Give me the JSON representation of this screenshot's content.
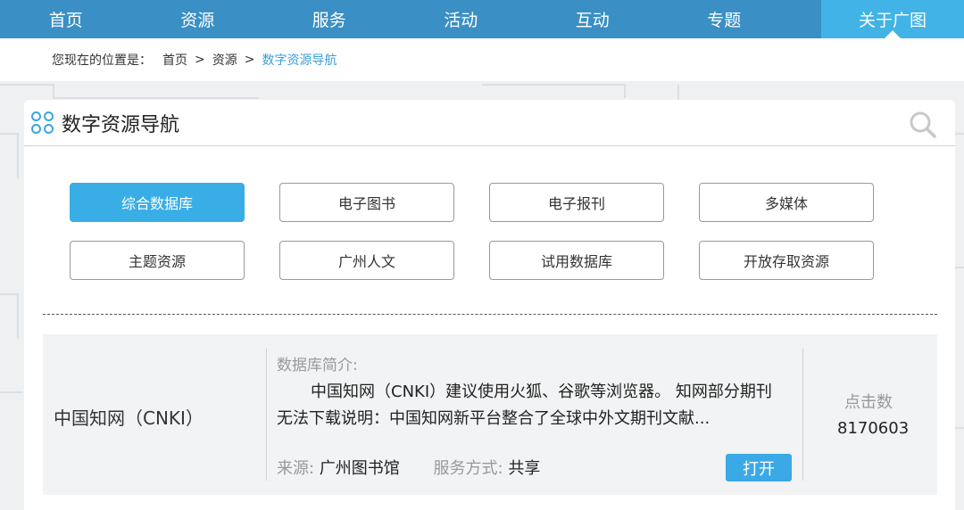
{
  "nav": {
    "items": [
      "首页",
      "资源",
      "服务",
      "活动",
      "互动",
      "专题"
    ],
    "active": "关于广图"
  },
  "breadcrumb": {
    "label": "您现在的位置是：",
    "items": [
      "首页",
      "资源"
    ],
    "separator": ">",
    "current": "数字资源导航"
  },
  "section": {
    "title": "数字资源导航"
  },
  "categories": [
    {
      "label": "综合数据库",
      "active": true
    },
    {
      "label": "电子图书",
      "active": false
    },
    {
      "label": "电子报刊",
      "active": false
    },
    {
      "label": "多媒体",
      "active": false
    },
    {
      "label": "主题资源",
      "active": false
    },
    {
      "label": "广州人文",
      "active": false
    },
    {
      "label": "试用数据库",
      "active": false
    },
    {
      "label": "开放存取资源",
      "active": false
    }
  ],
  "database": {
    "name": "中国知网（CNKI）",
    "desc_label": "数据库简介:",
    "desc": "中国知网（CNKI）建议使用火狐、谷歌等浏览器。 知网部分期刊无法下载说明：中国知网新平台整合了全球中外文期刊文献...",
    "source_label": "来源:",
    "source": "广州图书馆",
    "service_label": "服务方式:",
    "service": "共享",
    "open_label": "打开",
    "clicks_label": "点击数",
    "clicks": "8170603"
  },
  "colors": {
    "nav_bg": "#3a8fc4",
    "nav_active": "#41b3e6",
    "accent": "#38ade6"
  },
  "icons": [
    "dots-grid-icon",
    "search-icon"
  ]
}
